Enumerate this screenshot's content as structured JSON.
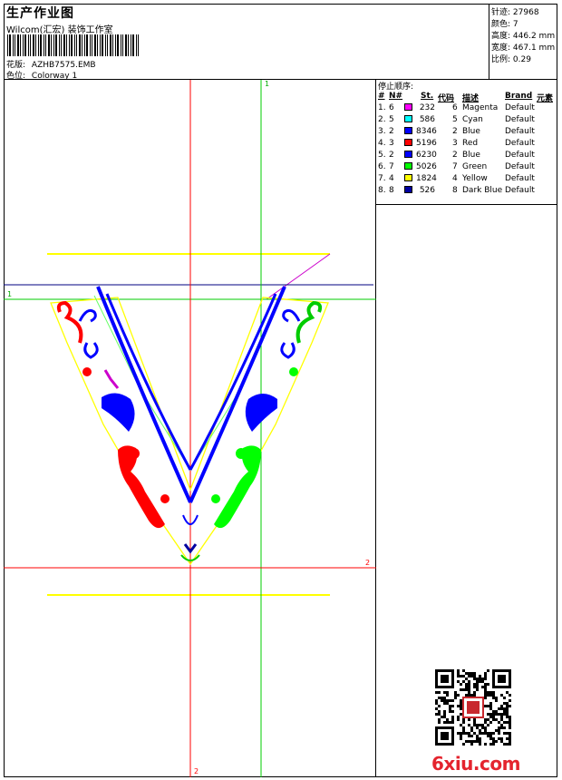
{
  "header": {
    "title": "生产作业图",
    "company": "Wilcom(汇宏) 装饰工作室",
    "design_label": "花版:",
    "design_value": "AZHB7575.EMB",
    "colorway_label": "色位:",
    "colorway_value": "Colorway 1"
  },
  "specs": [
    {
      "label": "针迹:",
      "value": "27968"
    },
    {
      "label": "颜色:",
      "value": "7"
    },
    {
      "label": "高度:",
      "value": "446.2 mm"
    },
    {
      "label": "宽度:",
      "value": "467.1 mm"
    },
    {
      "label": "比例:",
      "value": "0.29"
    }
  ],
  "stop_sequence": {
    "title": "停止顺序:",
    "columns": {
      "num": "#",
      "n": "N#",
      "stitches": "St.",
      "code": "代码",
      "desc": "描述",
      "brand": "Brand",
      "elements": "元素"
    },
    "rows": [
      {
        "num": "1.",
        "n": "6",
        "stitches": "232",
        "code": "6",
        "desc": "Magenta",
        "brand": "Default",
        "color": "#ff00ff"
      },
      {
        "num": "2.",
        "n": "5",
        "stitches": "586",
        "code": "5",
        "desc": "Cyan",
        "brand": "Default",
        "color": "#00ffff"
      },
      {
        "num": "3.",
        "n": "2",
        "stitches": "8346",
        "code": "2",
        "desc": "Blue",
        "brand": "Default",
        "color": "#0000ff"
      },
      {
        "num": "4.",
        "n": "3",
        "stitches": "5196",
        "code": "3",
        "desc": "Red",
        "brand": "Default",
        "color": "#ff0000"
      },
      {
        "num": "5.",
        "n": "2",
        "stitches": "6230",
        "code": "2",
        "desc": "Blue",
        "brand": "Default",
        "color": "#0000ff"
      },
      {
        "num": "6.",
        "n": "7",
        "stitches": "5026",
        "code": "7",
        "desc": "Green",
        "brand": "Default",
        "color": "#00ff00"
      },
      {
        "num": "7.",
        "n": "4",
        "stitches": "1824",
        "code": "4",
        "desc": "Yellow",
        "brand": "Default",
        "color": "#ffff00"
      },
      {
        "num": "8.",
        "n": "8",
        "stitches": "526",
        "code": "8",
        "desc": "Dark Blue",
        "brand": "Default",
        "color": "#0000a0"
      }
    ]
  },
  "guides": {
    "h1": "1",
    "v1": "1",
    "h2": "2",
    "v2": "2"
  },
  "watermark": "6xiu.com",
  "colors": {
    "guide_red": "#ff0000",
    "guide_green": "#00cc00",
    "guide_navy": "#000080",
    "embroidery_blue": "#0000ff",
    "embroidery_red": "#ff0000",
    "embroidery_green": "#00ff00",
    "embroidery_yellow": "#ffff00",
    "embroidery_magenta": "#cc00cc"
  }
}
